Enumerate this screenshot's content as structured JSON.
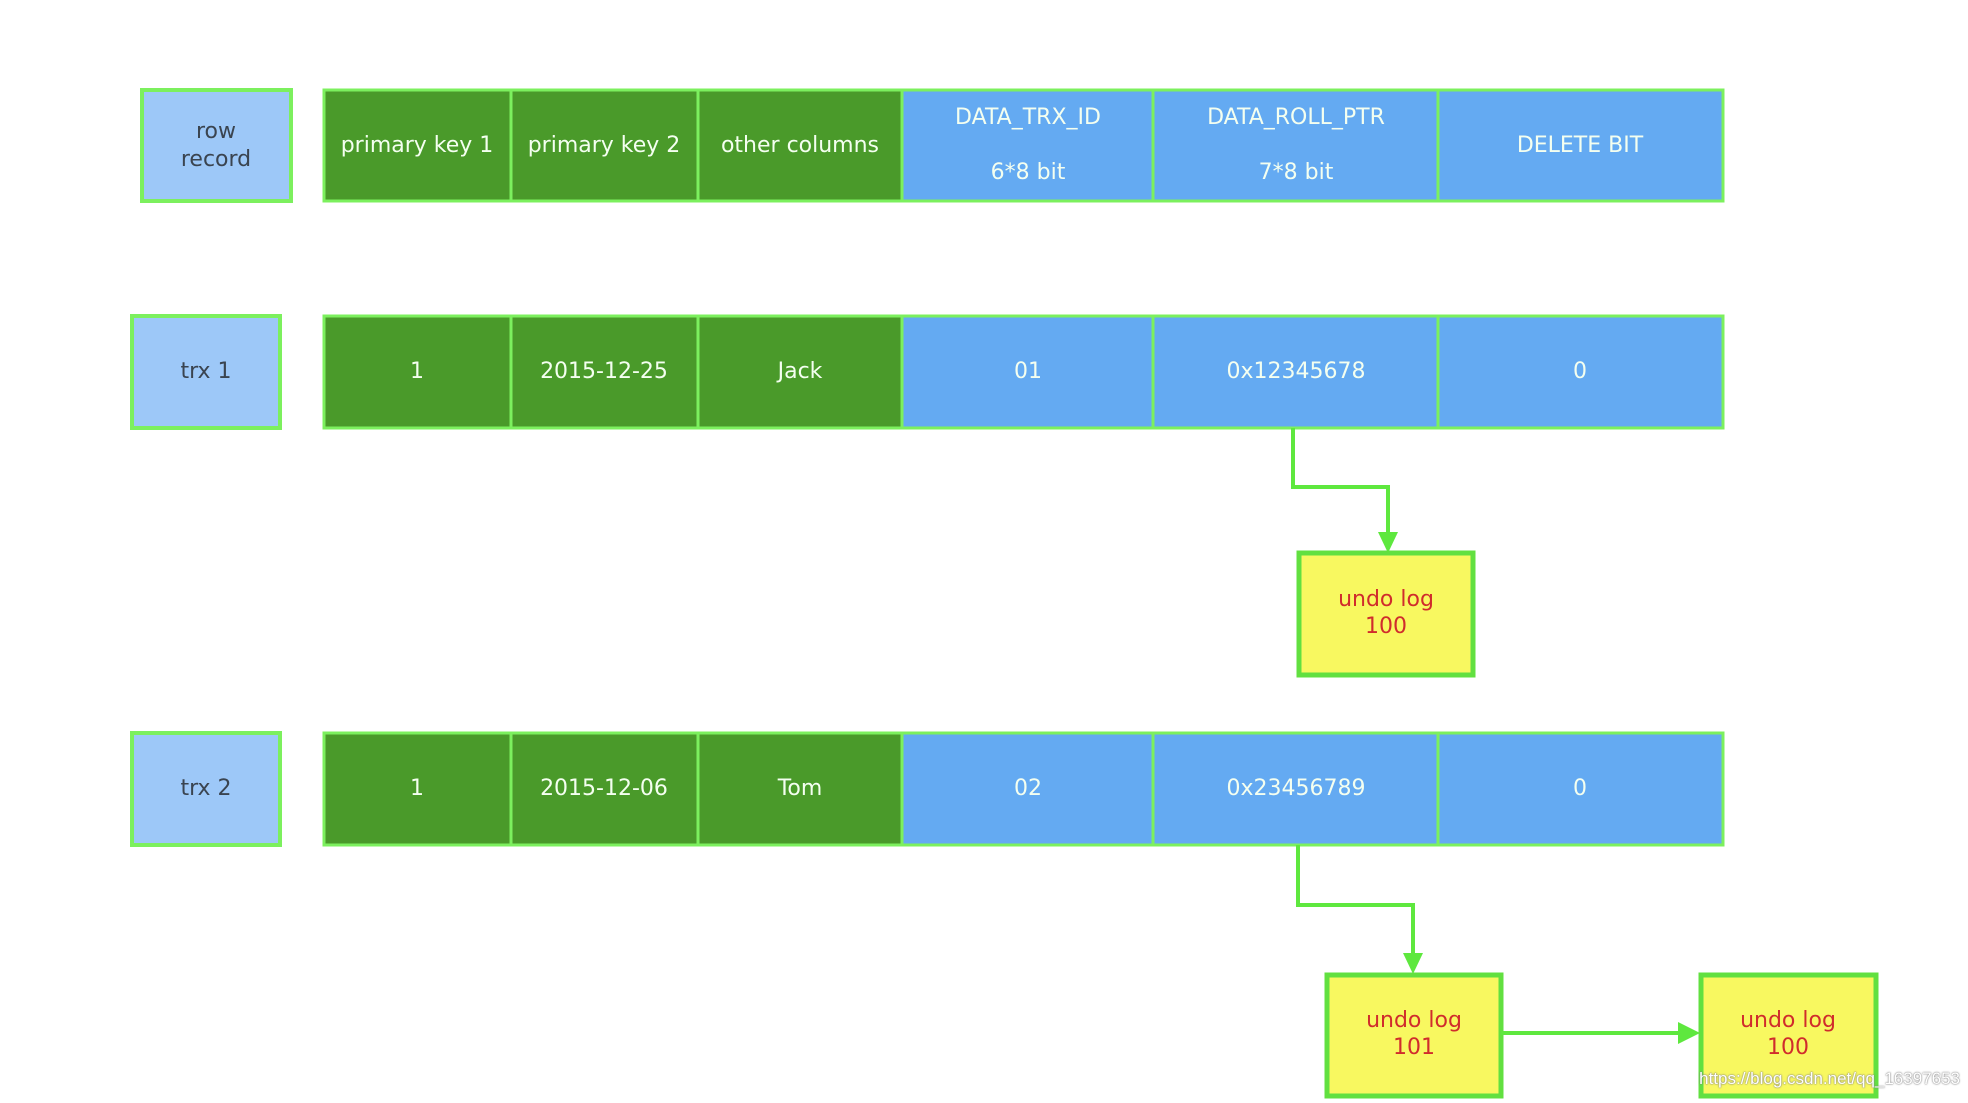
{
  "header_row": {
    "label": [
      "row",
      "record"
    ],
    "cells": [
      {
        "lines": [
          "primary key 1"
        ]
      },
      {
        "lines": [
          "primary key 2"
        ]
      },
      {
        "lines": [
          "other columns"
        ]
      },
      {
        "lines": [
          "DATA_TRX_ID",
          "6*8 bit"
        ]
      },
      {
        "lines": [
          "DATA_ROLL_PTR",
          "7*8 bit"
        ]
      },
      {
        "lines": [
          "DELETE BIT"
        ]
      }
    ]
  },
  "trx1": {
    "label": "trx 1",
    "cells": [
      "1",
      "2015-12-25",
      "Jack",
      "01",
      "0x12345678",
      "0"
    ]
  },
  "trx2": {
    "label": "trx 2",
    "cells": [
      "1",
      "2015-12-06",
      "Tom",
      "02",
      "0x23456789",
      "0"
    ]
  },
  "undo_logs": {
    "trx1_undo": [
      "undo log",
      "100"
    ],
    "trx2_undo_a": [
      "undo log",
      "101"
    ],
    "trx2_undo_b": [
      "undo log",
      "100"
    ]
  },
  "watermark": "https://blog.csdn.net/qq_16397653",
  "colors": {
    "data_columns": "#4a9a2a",
    "hidden_columns": "#64aaf2",
    "row_labels": "#9dc8f8",
    "borders_arrows": "#7cf05e",
    "undo_log": "#f8f860",
    "undo_text": "#d02c2c"
  }
}
